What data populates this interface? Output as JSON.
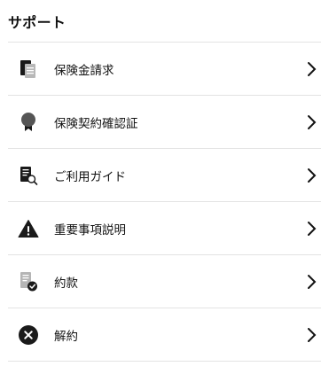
{
  "header": {
    "title": "サポート"
  },
  "menu": [
    {
      "label": "保険金請求",
      "icon": "document-stack-icon"
    },
    {
      "label": "保険契約確認証",
      "icon": "award-ribbon-icon"
    },
    {
      "label": "ご利用ガイド",
      "icon": "document-search-icon"
    },
    {
      "label": "重要事項説明",
      "icon": "warning-icon"
    },
    {
      "label": "約款",
      "icon": "document-check-icon"
    },
    {
      "label": "解約",
      "icon": "close-circle-icon"
    }
  ],
  "colors": {
    "icon": "#1a1a1a",
    "icon_light": "#b5b5b5",
    "divider": "#e3e3e3"
  }
}
